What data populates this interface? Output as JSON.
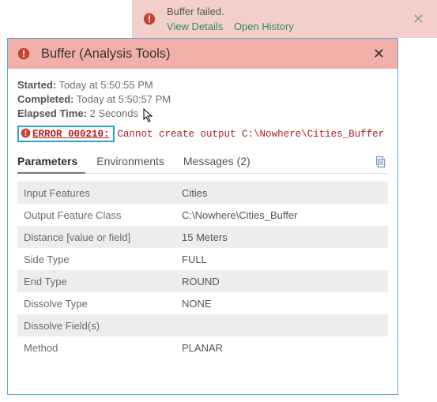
{
  "notification": {
    "title": "Buffer failed.",
    "view_details": "View Details",
    "open_history": "Open History"
  },
  "header": {
    "title": "Buffer (Analysis Tools)"
  },
  "meta": {
    "started_label": "Started:",
    "started_value": "Today at 5:50:55 PM",
    "completed_label": "Completed:",
    "completed_value": "Today at 5:50:57 PM",
    "elapsed_label": "Elapsed Time:",
    "elapsed_value": "2 Seconds"
  },
  "error": {
    "code": "ERROR 000210:",
    "message": "Cannot create output C:\\Nowhere\\Cities_Buffer"
  },
  "tabs": {
    "parameters": "Parameters",
    "environments": "Environments",
    "messages": "Messages (2)"
  },
  "parameters": [
    {
      "key": "Input Features",
      "value": "Cities"
    },
    {
      "key": "Output Feature Class",
      "value": "C:\\Nowhere\\Cities_Buffer"
    },
    {
      "key": "Distance [value or field]",
      "value": "15 Meters"
    },
    {
      "key": "Side Type",
      "value": "FULL"
    },
    {
      "key": "End Type",
      "value": "ROUND"
    },
    {
      "key": "Dissolve Type",
      "value": "NONE"
    },
    {
      "key": "Dissolve Field(s)",
      "value": ""
    },
    {
      "key": "Method",
      "value": "PLANAR"
    }
  ]
}
